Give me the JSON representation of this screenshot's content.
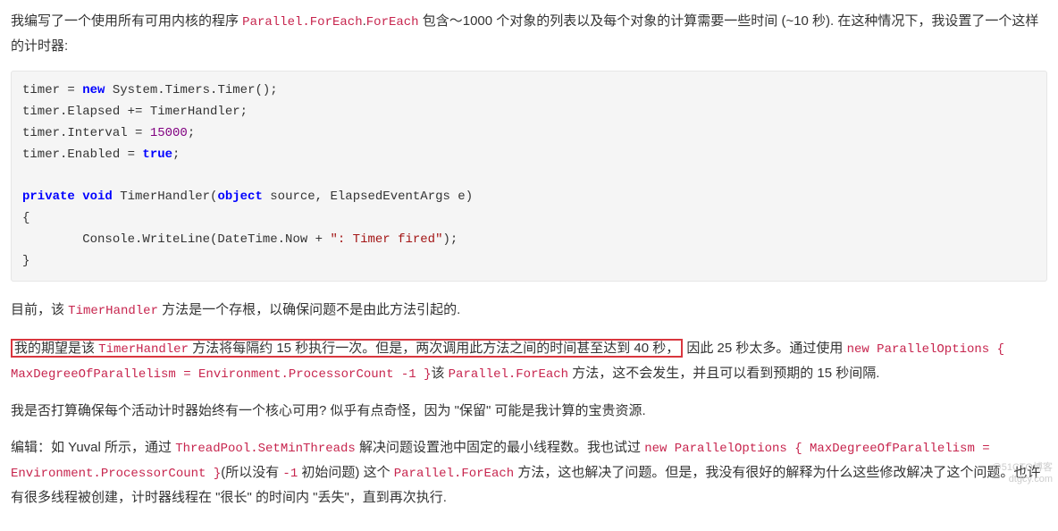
{
  "para1": {
    "t1": "我编写了一个使用所有可用内核的程序 ",
    "c1": "Parallel.ForEach",
    "t2": ".",
    "c2": "ForEach",
    "t3": " 包含～1000 个对象的列表以及每个对象的计算需要一些时间 (~10 秒). 在这种情况下，我设置了一个这样的计时器:"
  },
  "code": {
    "ln1a": "timer = ",
    "ln1kw": "new",
    "ln1b": " System.Timers.Timer();",
    "ln2": "timer.Elapsed += TimerHandler;",
    "ln3a": "timer.Interval = ",
    "ln3n": "15000",
    "ln3b": ";",
    "ln4a": "timer.Enabled = ",
    "ln4b": "true",
    "ln4c": ";",
    "blank": "",
    "ln5a": "private void",
    "ln5b": " TimerHandler(",
    "ln5c": "object",
    "ln5d": " source, ElapsedEventArgs e)",
    "ln6": "{",
    "ln7a": "        Console.WriteLine(DateTime.Now + ",
    "ln7s": "\": Timer fired\"",
    "ln7b": ");",
    "ln8": "}"
  },
  "para2": {
    "t1": "目前，该 ",
    "c1": "TimerHandler",
    "t2": " 方法是一个存根，以确保问题不是由此方法引起的."
  },
  "para3": {
    "hl1": "我的期望是该 ",
    "hlc": "TimerHandler",
    "hl2": " 方法将每隔约 15 秒执行一次。但是，两次调用此方法之间的时间甚至达到 40 秒，",
    "t1": " 因此 25 秒太多。通过使用 ",
    "c1": "new ParallelOptions { MaxDegreeOfParallelism = Environment.ProcessorCount -1 }",
    "t2": "该 ",
    "c2": "Parallel.ForEach",
    "t3": " 方法，这不会发生，并且可以看到预期的 15 秒间隔."
  },
  "para4": "我是否打算确保每个活动计时器始终有一个核心可用? 似乎有点奇怪，因为 \"保留\" 可能是我计算的宝贵资源.",
  "para5": {
    "t1": "编辑：如 Yuval 所示，通过 ",
    "c1": "ThreadPool.SetMinThreads",
    "t2": " 解决问题设置池中固定的最小线程数。我也试过 ",
    "c2": "new ParallelOptions { MaxDegreeOfParallelism = Environment.ProcessorCount }",
    "t3": "(所以没有 ",
    "c3": "-1",
    "t4": " 初始问题) 这个 ",
    "c4": "Parallel.ForEach",
    "t5": " 方法，这也解决了问题。但是，我没有很好的解释为什么这些修改解决了这个问题。也许有很多线程被创建，计时器线程在 \"很长\" 的时间内 \"丢失\"，直到再次执行."
  },
  "watermark": {
    "l1": "@51CTO博客",
    "l2": "dtgcy.com"
  }
}
